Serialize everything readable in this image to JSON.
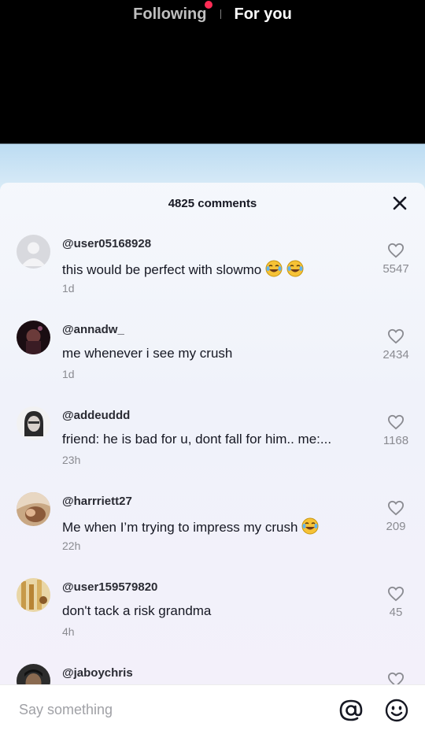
{
  "top_nav": {
    "following_label": "Following",
    "for_you_label": "For you"
  },
  "comments_panel": {
    "count_label": "4825 comments",
    "comments": [
      {
        "username": "@user05168928",
        "text": "this would be perfect with slowmo",
        "emoji_count": 2,
        "time": "1d",
        "likes": "5547"
      },
      {
        "username": "@annadw_",
        "text": "me whenever i see my crush",
        "emoji_count": 0,
        "time": "1d",
        "likes": "2434"
      },
      {
        "username": "@addeuddd",
        "text": "friend: he is bad for u, dont fall for him.. me:...",
        "emoji_count": 0,
        "time": "23h",
        "likes": "1168"
      },
      {
        "username": "@harrriett27",
        "text": "Me when I’m trying to impress my crush",
        "emoji_count": 1,
        "time": "22h",
        "likes": "209"
      },
      {
        "username": "@user159579820",
        "text": "don't tack a risk grandma",
        "emoji_count": 0,
        "time": "4h",
        "likes": "45"
      },
      {
        "username": "@jaboychris",
        "text": "",
        "emoji_count": 0,
        "time": "",
        "likes": ""
      }
    ]
  },
  "input_bar": {
    "placeholder": "Say something",
    "mention_icon": "at-sign-icon",
    "emoji_icon": "smiley-icon"
  },
  "colors": {
    "notification_dot": "#fe2c55",
    "text_primary": "#161823",
    "text_secondary": "#8a8b91"
  }
}
